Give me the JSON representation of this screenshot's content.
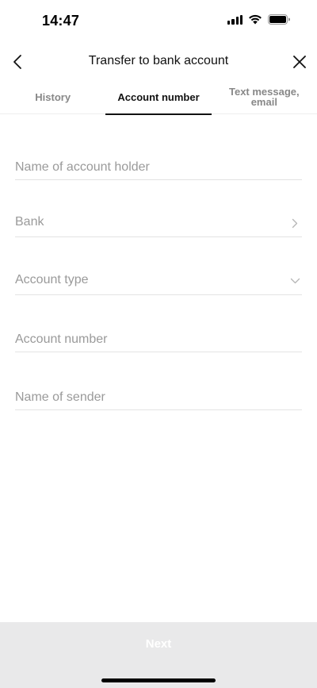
{
  "status_bar": {
    "time": "14:47"
  },
  "nav": {
    "title": "Transfer to bank account",
    "back_icon": "chevron-left-icon",
    "close_icon": "close-icon"
  },
  "tabs": [
    {
      "label": "History",
      "active": false
    },
    {
      "label": "Account number",
      "active": true
    },
    {
      "label": "Text message,\nemail",
      "active": false
    }
  ],
  "form": {
    "account_holder": {
      "placeholder": "Name of account holder",
      "value": ""
    },
    "bank": {
      "label": "Bank",
      "trailing_icon": "chevron-right-icon"
    },
    "account_type": {
      "label": "Account type",
      "trailing_icon": "chevron-down-icon"
    },
    "account_number": {
      "placeholder": "Account number",
      "value": ""
    },
    "sender_name": {
      "placeholder": "Name of sender",
      "value": ""
    }
  },
  "footer": {
    "next_label": "Next"
  }
}
